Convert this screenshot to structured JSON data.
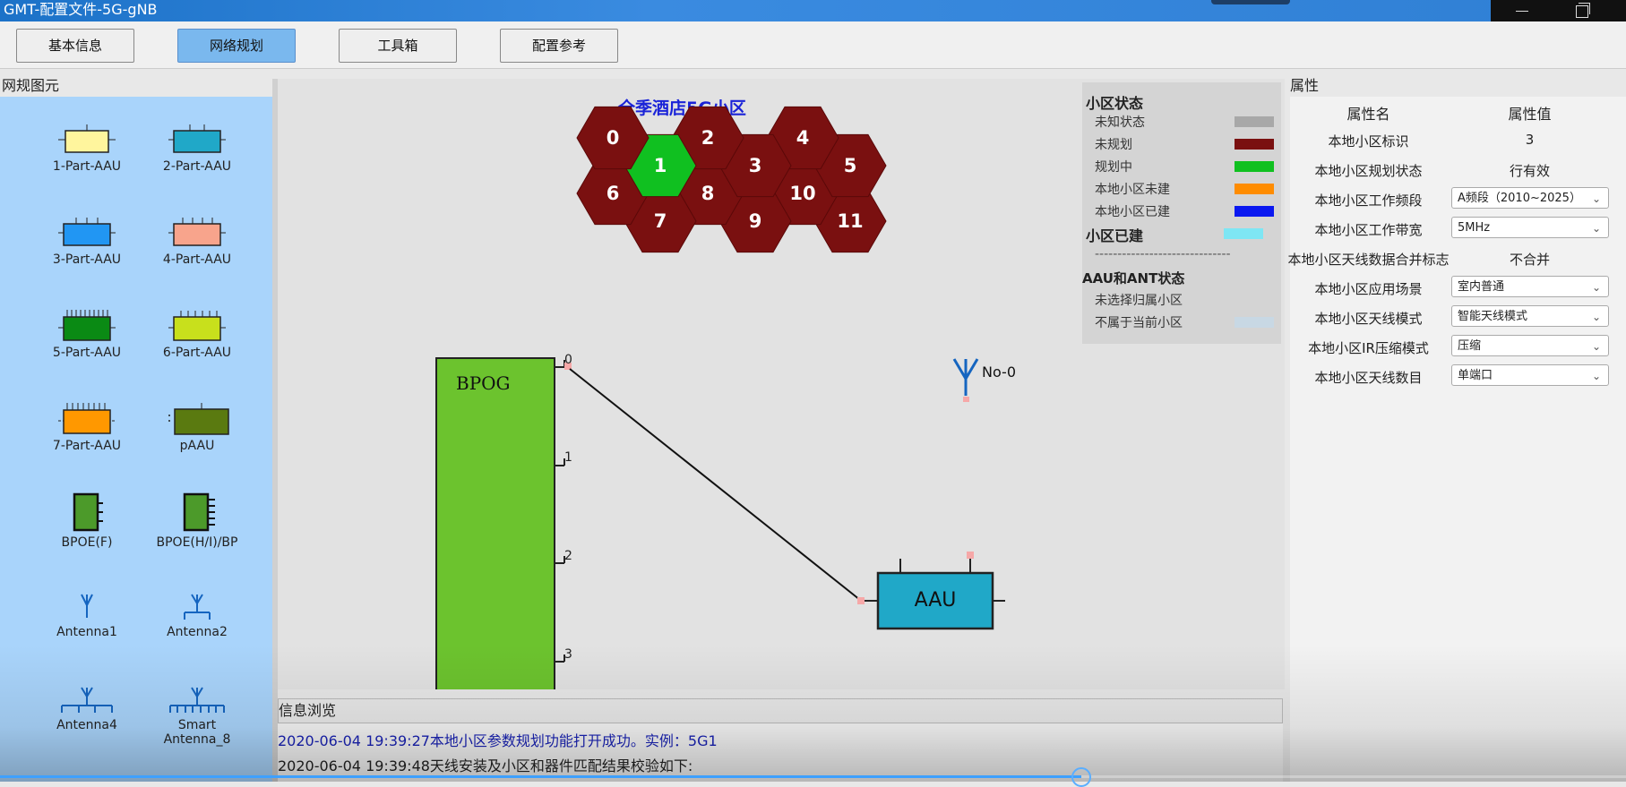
{
  "window": {
    "title": "GMT-配置文件-5G-gNB"
  },
  "toolbar": {
    "buttons": [
      {
        "label": "基本信息",
        "active": false
      },
      {
        "label": "网络规划",
        "active": true
      },
      {
        "label": "工具箱",
        "active": false
      },
      {
        "label": "配置参考",
        "active": false
      }
    ]
  },
  "palette": {
    "title": "网规图元",
    "items": [
      {
        "label": "1-Part-AAU",
        "icon": "aau-1part-icon",
        "color": "#fff59d"
      },
      {
        "label": "2-Part-AAU",
        "icon": "aau-2part-icon",
        "color": "#20a8c8"
      },
      {
        "label": "3-Part-AAU",
        "icon": "aau-3part-icon",
        "color": "#2196f3"
      },
      {
        "label": "4-Part-AAU",
        "icon": "aau-4part-icon",
        "color": "#f8a48c"
      },
      {
        "label": "5-Part-AAU",
        "icon": "aau-5part-icon",
        "color": "#0a8a14"
      },
      {
        "label": "6-Part-AAU",
        "icon": "aau-6part-icon",
        "color": "#c8e01c"
      },
      {
        "label": "7-Part-AAU",
        "icon": "aau-7part-icon",
        "color": "#ff9800"
      },
      {
        "label": "pAAU",
        "icon": "paau-icon",
        "color": "#5a7a10"
      },
      {
        "label": "BPOE(F)",
        "icon": "bpoe-f-icon",
        "color": "#4c9a2a"
      },
      {
        "label": "BPOE(H/I)/BP",
        "icon": "bpoe-hi-icon",
        "color": "#4c9a2a"
      },
      {
        "label": "Antenna1",
        "icon": "antenna1-icon",
        "color": "#1565c0"
      },
      {
        "label": "Antenna2",
        "icon": "antenna2-icon",
        "color": "#1565c0"
      },
      {
        "label": "Antenna4",
        "icon": "antenna4-icon",
        "color": "#1565c0"
      },
      {
        "label": "Smart Antenna_8",
        "icon": "smart-antenna8-icon",
        "color": "#1565c0"
      }
    ]
  },
  "canvas": {
    "cell_title": "全季酒店5G小区",
    "cells": [
      {
        "id": "0",
        "status": "未规划"
      },
      {
        "id": "1",
        "status": "规划中"
      },
      {
        "id": "2",
        "status": "未规划"
      },
      {
        "id": "3",
        "status": "未规划"
      },
      {
        "id": "4",
        "status": "未规划"
      },
      {
        "id": "5",
        "status": "未规划"
      },
      {
        "id": "6",
        "status": "未规划"
      },
      {
        "id": "7",
        "status": "未规划"
      },
      {
        "id": "8",
        "status": "未规划"
      },
      {
        "id": "9",
        "status": "未规划"
      },
      {
        "id": "10",
        "status": "未规划"
      },
      {
        "id": "11",
        "status": "未规划"
      }
    ],
    "bpog": {
      "label": "BPOG",
      "ports": [
        "0",
        "1",
        "2",
        "3"
      ]
    },
    "aau": {
      "label": "AAU"
    },
    "antenna": {
      "label": "No-0"
    }
  },
  "legend": {
    "cell_status_title": "小区状态",
    "cell_status": [
      {
        "label": "未知状态",
        "color": "#a8a8a8"
      },
      {
        "label": "未规划",
        "color": "#7a1010"
      },
      {
        "label": "规划中",
        "color": "#10c020"
      },
      {
        "label": "本地小区未建",
        "color": "#ff8c00"
      },
      {
        "label": "本地小区已建",
        "color": "#0a18f0"
      }
    ],
    "cell_built_title": "小区已建",
    "cell_built_color": "#7ee6f4",
    "separator": "------------------------------",
    "aau_ant_title": "AAU和ANT状态",
    "aau_ant": [
      {
        "label": "未选择归属小区"
      },
      {
        "label": "不属于当前小区"
      }
    ]
  },
  "props": {
    "title": "属性",
    "header_name": "属性名",
    "header_value": "属性值",
    "rows": [
      {
        "name": "本地小区标识",
        "value": "3",
        "type": "text"
      },
      {
        "name": "本地小区规划状态",
        "value": "行有效",
        "type": "text"
      },
      {
        "name": "本地小区工作频段",
        "value": "A频段（2010~2025）",
        "type": "select"
      },
      {
        "name": "本地小区工作带宽",
        "value": "5MHz",
        "type": "select"
      },
      {
        "name": "本地小区天线数据合并标志",
        "value": "不合并",
        "type": "text"
      },
      {
        "name": "本地小区应用场景",
        "value": "室内普通",
        "type": "select"
      },
      {
        "name": "本地小区天线模式",
        "value": "智能天线模式",
        "type": "select"
      },
      {
        "name": "本地小区IR压缩模式",
        "value": "压缩",
        "type": "select"
      },
      {
        "name": "本地小区天线数目",
        "value": "单端口",
        "type": "select"
      }
    ]
  },
  "info": {
    "title": "信息浏览",
    "lines": [
      "2020-06-04 19:39:27本地小区参数规划功能打开成功。实例：5G1",
      "2020-06-04 19:39:48天线安装及小区和器件匹配结果校验如下:"
    ]
  },
  "video_progress": 0.665
}
